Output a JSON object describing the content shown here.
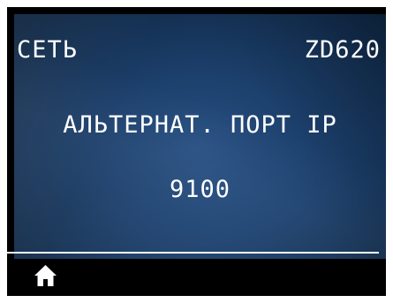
{
  "header": {
    "menu_title": "СЕТЬ",
    "model": "ZD620"
  },
  "main": {
    "parameter_label": "АЛЬТЕРНАТ. ПОРТ IP",
    "parameter_value": "9100"
  },
  "footer": {
    "home_icon": "home-icon"
  },
  "colors": {
    "screen_background": "#1f4677",
    "text": "#ffffff",
    "bezel": "#000000"
  }
}
